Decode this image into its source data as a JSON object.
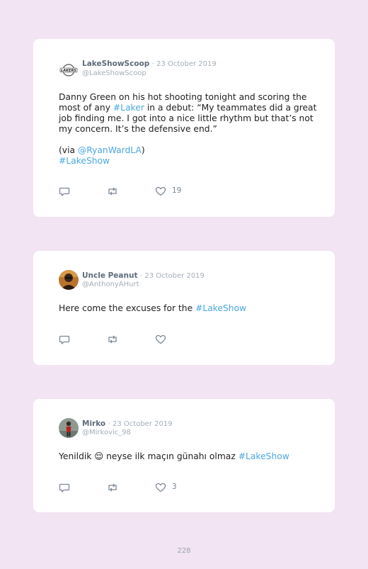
{
  "tweets": [
    {
      "name": "LakeShowScoop",
      "separator": "·",
      "date": "23 October 2019",
      "handle": "@LakeShowScoop",
      "avatar_icon": "lakers-logo-icon",
      "text_parts": {
        "p1": "Danny Green on his hot shooting tonight and scoring the most of any ",
        "hashtag1": "#Laker",
        "p2": " in a debut: “My teammates did a great job finding me. I got into a nice little rhythm but that’s not my concern. It’s the defensive end.”",
        "via_open": "(via ",
        "mention": "@RyanWardLA",
        "via_close": ")",
        "hashtag2": "#LakeShow"
      },
      "likes": "19"
    },
    {
      "name": "Uncle Peanut",
      "separator": "·",
      "date": "23 October 2019",
      "handle": "@AnthonyAHurt",
      "avatar_icon": "user-avatar-icon",
      "text_parts": {
        "p1": "Here come the excuses for the ",
        "hashtag1": "#LakeShow"
      },
      "likes": ""
    },
    {
      "name": "Mirko",
      "separator": "·",
      "date": "23 October 2019",
      "handle": "@Mirkovic_98",
      "avatar_icon": "user-avatar-icon",
      "text_parts": {
        "p1": "Yenildik ",
        "emoji": "😌",
        "p2": " neyse ilk maçın günahı olmaz ",
        "hashtag1": "#LakeShow"
      },
      "likes": "3"
    }
  ],
  "icons": {
    "reply": "reply-icon",
    "retweet": "retweet-icon",
    "like": "heart-icon"
  },
  "colors": {
    "background": "#f2e4f2",
    "card": "#ffffff",
    "link": "#4aa8e0"
  },
  "page_number": "228"
}
